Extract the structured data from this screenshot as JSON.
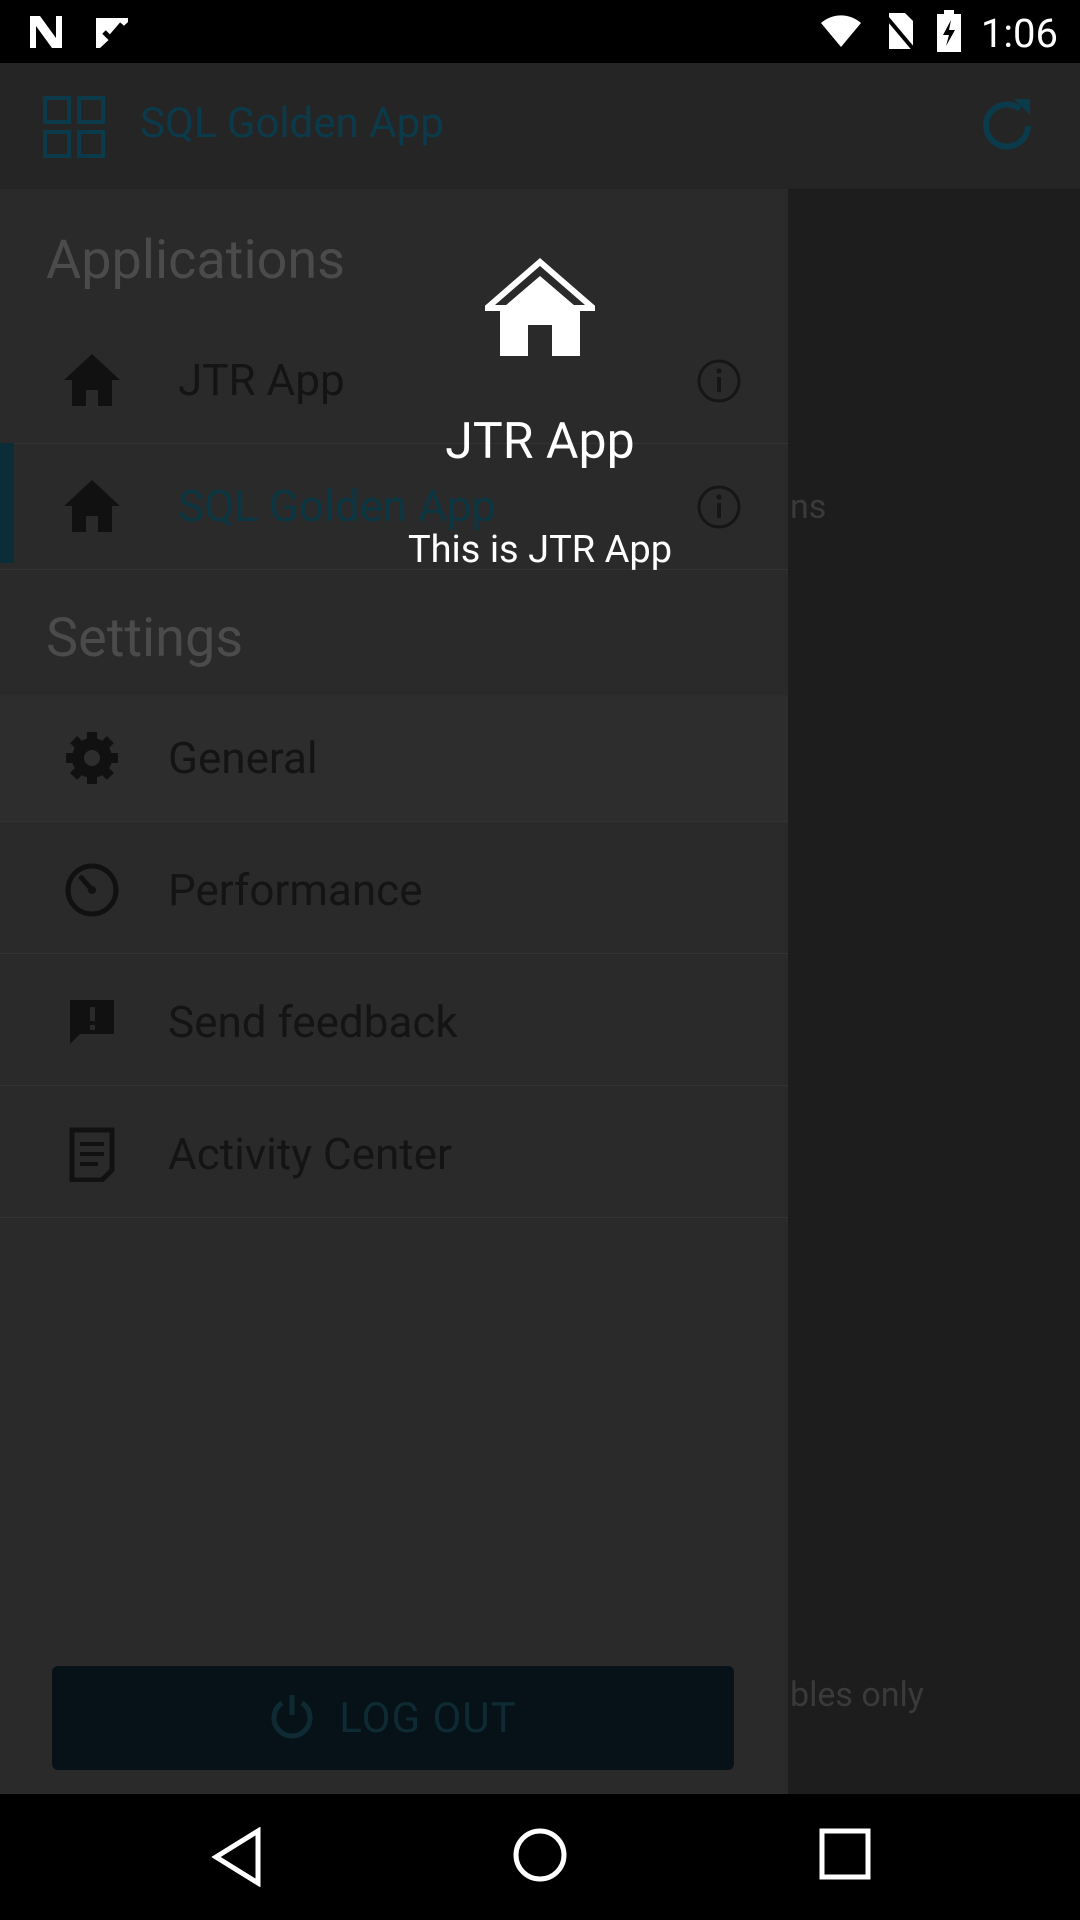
{
  "status_bar": {
    "time": "1:06",
    "icons": [
      "notification-n-icon",
      "check-icon",
      "wifi-icon",
      "no-sim-icon",
      "battery-charging-icon"
    ]
  },
  "app_bar": {
    "title": "SQL Golden App",
    "icons": [
      "grid-icon",
      "refresh-icon"
    ]
  },
  "background": {
    "text_1": "ns",
    "text_2": "bles only"
  },
  "drawer": {
    "applications_title": "Applications",
    "apps": [
      {
        "label": "JTR App",
        "icon": "home-icon",
        "active": false
      },
      {
        "label": "SQL Golden App",
        "icon": "home-icon",
        "active": true
      }
    ],
    "settings_title": "Settings",
    "settings": [
      {
        "label": "General",
        "icon": "gear-icon"
      },
      {
        "label": "Performance",
        "icon": "speedometer-icon"
      },
      {
        "label": "Send feedback",
        "icon": "feedback-icon"
      },
      {
        "label": "Activity Center",
        "icon": "document-icon"
      }
    ],
    "logout_label": "LOG OUT"
  },
  "overlay": {
    "title": "JTR App",
    "description": "This is JTR App",
    "icon": "home-icon"
  },
  "nav_bar": {
    "icons": [
      "back-icon",
      "home-circle-icon",
      "recents-icon"
    ]
  },
  "colors": {
    "accent_dim": "#0b3a4a",
    "drawer_bg": "#2a2a2a",
    "overlay_text": "#ffffff"
  }
}
